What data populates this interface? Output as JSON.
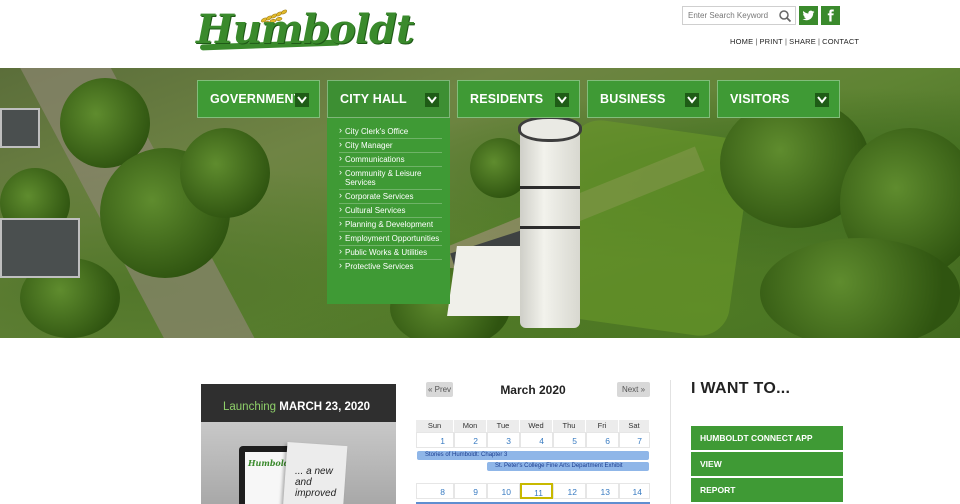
{
  "header": {
    "logo_text": "Humboldt",
    "search_placeholder": "Enter Search Keyword",
    "util_links": [
      "HOME",
      "PRINT",
      "SHARE",
      "CONTACT"
    ]
  },
  "nav": {
    "items": [
      {
        "label": "GOVERNMENT"
      },
      {
        "label": "CITY HALL"
      },
      {
        "label": "RESIDENTS"
      },
      {
        "label": "BUSINESS"
      },
      {
        "label": "VISITORS"
      }
    ],
    "dropdown": [
      "City Clerk's Office",
      "City Manager",
      "Communications",
      "Community & Leisure Services",
      "Corporate Services",
      "Cultural Services",
      "Planning & Development",
      "Employment Opportunities",
      "Public Works & Utilities",
      "Protective Services"
    ]
  },
  "launch": {
    "prefix": "Launching",
    "date": "MARCH 23, 2020",
    "mini_logo": "Humboldt",
    "tagline": "... a new and improved"
  },
  "calendar": {
    "prev": "« Prev",
    "next": "Next »",
    "title": "March 2020",
    "weekdays": [
      "Sun",
      "Mon",
      "Tue",
      "Wed",
      "Thu",
      "Fri",
      "Sat"
    ],
    "week1": [
      "1",
      "2",
      "3",
      "4",
      "5",
      "6",
      "7"
    ],
    "week2": [
      "8",
      "9",
      "10",
      "11",
      "12",
      "13",
      "14"
    ],
    "events": [
      "Stories of Humboldt: Chapter 3",
      "St. Peter's College Fine Arts Department Exhibit"
    ]
  },
  "iwant": {
    "title": "I WANT TO...",
    "buttons": [
      "HUMBOLDT CONNECT APP",
      "VIEW",
      "REPORT"
    ]
  },
  "colors": {
    "brand_green": "#3f9a35",
    "dark_green": "#1e5c16",
    "link_blue": "#3a7cc2"
  }
}
